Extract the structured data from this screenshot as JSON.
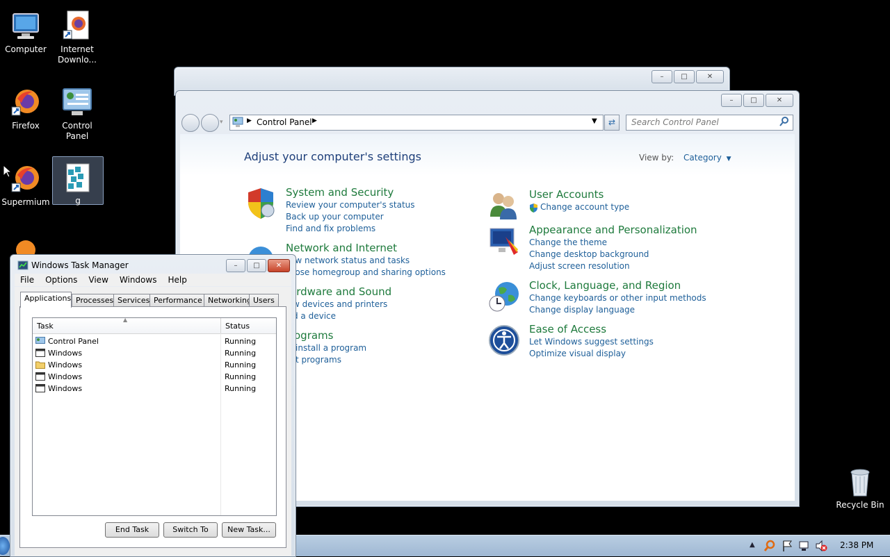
{
  "desktop": {
    "icons": [
      {
        "label": "Computer"
      },
      {
        "label": "Internet Downlo..."
      },
      {
        "label": "Firefox"
      },
      {
        "label": "Control Panel"
      },
      {
        "label": "Supermium"
      },
      {
        "label": "g"
      },
      {
        "label": "Recycle Bin"
      }
    ]
  },
  "control_panel": {
    "address": {
      "crumb": "Control Panel"
    },
    "search": {
      "placeholder": "Search Control Panel"
    },
    "heading": "Adjust your computer's settings",
    "view_by_label": "View by:",
    "view_by_value": "Category",
    "categories": [
      {
        "title": "System and Security",
        "links": [
          "Review your computer's status",
          "Back up your computer",
          "Find and fix problems"
        ]
      },
      {
        "title": "Network and Internet",
        "links": [
          "ew network status and tasks",
          "oose homegroup and sharing options"
        ]
      },
      {
        "title": "ardware and Sound",
        "links": [
          "w devices and printers",
          "d a device"
        ]
      },
      {
        "title": "ograms",
        "links": [
          "install a program",
          "t programs"
        ]
      },
      {
        "title": "User Accounts",
        "links": [
          "Change account type"
        ]
      },
      {
        "title": "Appearance and Personalization",
        "links": [
          "Change the theme",
          "Change desktop background",
          "Adjust screen resolution"
        ]
      },
      {
        "title": "Clock, Language, and Region",
        "links": [
          "Change keyboards or other input methods",
          "Change display language"
        ]
      },
      {
        "title": "Ease of Access",
        "links": [
          "Let Windows suggest settings",
          "Optimize visual display"
        ]
      }
    ]
  },
  "task_manager": {
    "title": "Windows Task Manager",
    "menu": [
      "File",
      "Options",
      "View",
      "Windows",
      "Help"
    ],
    "tabs": [
      "Applications",
      "Processes",
      "Services",
      "Performance",
      "Networking",
      "Users"
    ],
    "columns": {
      "task": "Task",
      "status": "Status"
    },
    "rows": [
      {
        "task": "Control Panel",
        "status": "Running",
        "icon": "control-panel-icon"
      },
      {
        "task": "Windows",
        "status": "Running",
        "icon": "window-icon"
      },
      {
        "task": "Windows",
        "status": "Running",
        "icon": "folder-icon"
      },
      {
        "task": "Windows",
        "status": "Running",
        "icon": "window-icon"
      },
      {
        "task": "Windows",
        "status": "Running",
        "icon": "window-icon"
      }
    ],
    "buttons": {
      "end_task": "End Task",
      "switch_to": "Switch To",
      "new_task": "New Task..."
    }
  },
  "taskbar": {
    "clock": "2:38 PM"
  },
  "colors": {
    "link": "#1e5f99",
    "category_title": "#1e7a3c",
    "heading": "#1e3f7a"
  }
}
